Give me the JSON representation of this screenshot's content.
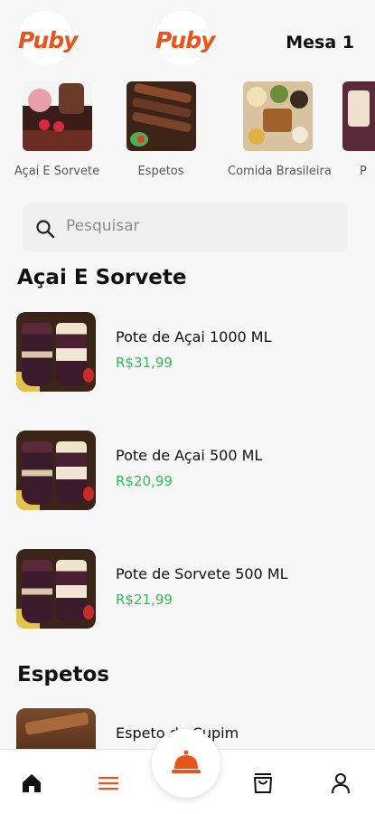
{
  "header": {
    "logo_left": "Puby",
    "logo_center": "Puby",
    "table": "Mesa 1",
    "brand_color": "#e8541a"
  },
  "categories": [
    {
      "label": "Açai E Sorvete"
    },
    {
      "label": "Espetos"
    },
    {
      "label": "Comida Brasileira"
    },
    {
      "label": "P"
    }
  ],
  "search": {
    "placeholder": "Pesquisar",
    "icon": "search-icon"
  },
  "sections": [
    {
      "title": "Açai E Sorvete",
      "items": [
        {
          "name": "Pote de Açai 1000 ML",
          "price": "R$31,99"
        },
        {
          "name": "Pote de Açai 500 ML",
          "price": "R$20,99"
        },
        {
          "name": "Pote de Sorvete 500 ML",
          "price": "R$21,99"
        }
      ]
    },
    {
      "title": "Espetos",
      "items": [
        {
          "name": "Espeto de Cupim",
          "price": ""
        }
      ]
    }
  ],
  "navbar": {
    "items": [
      "home-icon",
      "menu-icon",
      "bell-icon",
      "bag-icon",
      "user-icon"
    ],
    "active": "menu-icon",
    "active_color": "#e8541a",
    "price_color": "#2ebd59"
  }
}
